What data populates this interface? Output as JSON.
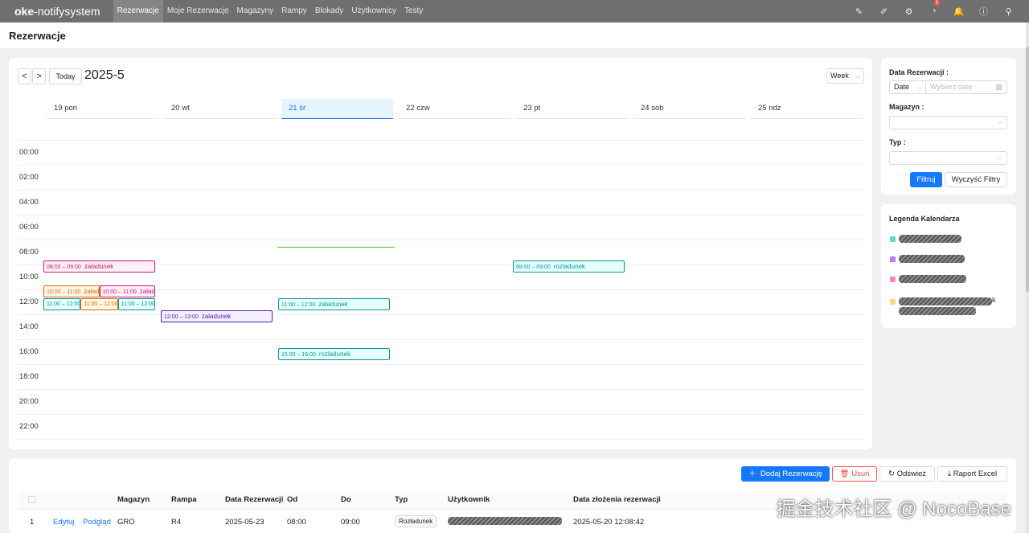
{
  "app": {
    "brand_bold": "oke",
    "brand_rest": "-notifysystem",
    "nav": [
      "Rezerwacje",
      "Moje Rezerwacje",
      "Magazyny",
      "Rampy",
      "Blokady",
      "Użytkownicy",
      "Testy"
    ],
    "active_nav": "Rezerwacje",
    "notification_count": "5",
    "top_icons": [
      "brush-icon",
      "highlighter-icon",
      "gear-icon",
      "checklist-icon",
      "bell-icon",
      "help-icon",
      "user-icon"
    ]
  },
  "page": {
    "title": "Rezerwacje"
  },
  "calendar": {
    "prev": "<",
    "next": ">",
    "today_label": "Today",
    "period": "2025-5",
    "view": "Week",
    "days": [
      "19 pon",
      "20 wt",
      "21 śr",
      "22 czw",
      "23 pt",
      "24 sob",
      "25 ndz"
    ],
    "today_index": 2,
    "times": [
      "00:00",
      "02:00",
      "04:00",
      "06:00",
      "08:00",
      "10:00",
      "12:00",
      "14:00",
      "16:00",
      "18:00",
      "20:00",
      "22:00"
    ],
    "events": [
      {
        "day": 0,
        "col": 0,
        "cols": 1,
        "start": 8,
        "end": 9,
        "time": "08:00 – 09:00",
        "label": "zaladunek",
        "color": "pink"
      },
      {
        "day": 0,
        "col": 0,
        "cols": 2,
        "start": 10,
        "end": 11,
        "time": "10:00 – 11:00",
        "label": "zalad",
        "color": "orange"
      },
      {
        "day": 0,
        "col": 1,
        "cols": 2,
        "start": 10,
        "end": 11,
        "time": "10:00 – 11:00",
        "label": "zalad",
        "color": "pink"
      },
      {
        "day": 0,
        "col": 0,
        "cols": 3,
        "start": 11,
        "end": 12,
        "time": "11:00 – 12:00",
        "label": "",
        "color": "cyan"
      },
      {
        "day": 0,
        "col": 1,
        "cols": 3,
        "start": 11,
        "end": 12,
        "time": "11:00 – 12:00",
        "label": "",
        "color": "orange"
      },
      {
        "day": 0,
        "col": 2,
        "cols": 3,
        "start": 11,
        "end": 12,
        "time": "11:00 – 12:00",
        "label": "",
        "color": "cyan"
      },
      {
        "day": 1,
        "col": 0,
        "cols": 1,
        "start": 12,
        "end": 13,
        "time": "12:00 – 13:00",
        "label": "zaladunek",
        "color": "purple"
      },
      {
        "day": 2,
        "col": 0,
        "cols": 1,
        "start": 11,
        "end": 12,
        "time": "11:00 – 12:00",
        "label": "zaladunek",
        "color": "cyan"
      },
      {
        "day": 2,
        "col": 0,
        "cols": 1,
        "start": 15,
        "end": 16,
        "time": "15:00 – 16:00",
        "label": "rozladunek",
        "color": "cyan"
      },
      {
        "day": 4,
        "col": 0,
        "cols": 1,
        "start": 8,
        "end": 9,
        "time": "08:00 – 09:00",
        "label": "rozladunek",
        "color": "cyan"
      }
    ]
  },
  "filters": {
    "date_label": "Data Rezerwacji :",
    "date_type": "Date",
    "date_placeholder": "Wybierz datę",
    "warehouse_label": "Magazyn :",
    "type_label": "Typ :",
    "apply": "Filtruj",
    "clear": "Wyczyść Filtry"
  },
  "legend": {
    "title": "Legenda Kalendarza",
    "items": [
      {
        "color": "#5cdbd3",
        "visible_text": ""
      },
      {
        "color": "#b37feb",
        "visible_text": ""
      },
      {
        "color": "#ff85c0",
        "visible_text": ""
      },
      {
        "color": "#ffd591",
        "visible_text": "k"
      }
    ]
  },
  "table": {
    "actions": {
      "add": "Dodaj Rezerwację",
      "delete": "Usuń",
      "refresh": "Odśwież",
      "export": "Raport Excel"
    },
    "columns": [
      "Magazyn",
      "Rampa",
      "Data Rezerwacji",
      "Od",
      "Do",
      "Typ",
      "Użytkownik",
      "Data złożenia rezerwacji"
    ],
    "rows": [
      {
        "index": "1",
        "edit": "Edytuj",
        "view": "Podgląd",
        "magazyn": "GRO",
        "rampa": "R4",
        "data": "2025-05-23",
        "od": "08:00",
        "do": "09:00",
        "typ": "Rozładunek",
        "uzytkownik": "",
        "zlozenie": "2025-05-20 12:08:42"
      }
    ]
  },
  "watermark": "掘金技术社区 @ NocoBase"
}
